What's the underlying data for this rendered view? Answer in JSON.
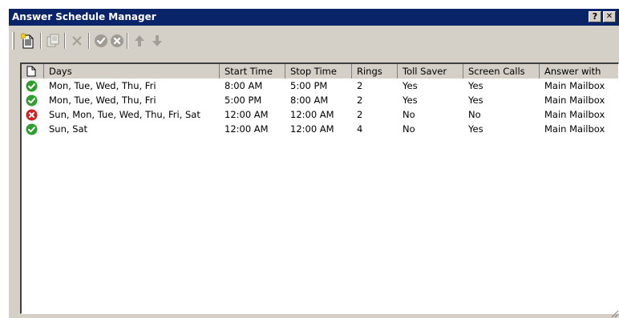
{
  "window": {
    "title": "Answer Schedule Manager",
    "help_label": "?",
    "close_label": "✕"
  },
  "toolbar": {
    "buttons": [
      {
        "name": "new-schedule",
        "icon": "new-document-icon",
        "enabled": true
      },
      {
        "name": "properties",
        "icon": "properties-icon",
        "enabled": false
      },
      {
        "name": "delete",
        "icon": "delete-icon",
        "enabled": false
      },
      {
        "name": "enable",
        "icon": "check-icon",
        "enabled": false
      },
      {
        "name": "disable",
        "icon": "disable-icon",
        "enabled": false
      },
      {
        "name": "move-up",
        "icon": "arrow-up-icon",
        "enabled": false
      },
      {
        "name": "move-down",
        "icon": "arrow-down-icon",
        "enabled": false
      }
    ]
  },
  "table": {
    "columns": [
      "",
      "Days",
      "Start Time",
      "Stop Time",
      "Rings",
      "Toll Saver",
      "Screen Calls",
      "Answer with"
    ],
    "rows": [
      {
        "status": "enabled",
        "days": "Mon, Tue, Wed, Thu, Fri",
        "start": "8:00 AM",
        "stop": "5:00 PM",
        "rings": "2",
        "toll_saver": "Yes",
        "screen_calls": "Yes",
        "answer_with": "Main Mailbox"
      },
      {
        "status": "enabled",
        "days": "Mon, Tue, Wed, Thu, Fri",
        "start": "5:00 PM",
        "stop": "8:00 AM",
        "rings": "2",
        "toll_saver": "Yes",
        "screen_calls": "Yes",
        "answer_with": "Main Mailbox"
      },
      {
        "status": "disabled",
        "days": "Sun, Mon, Tue, Wed, Thu, Fri, Sat",
        "start": "12:00 AM",
        "stop": "12:00 AM",
        "rings": "2",
        "toll_saver": "No",
        "screen_calls": "No",
        "answer_with": "Main Mailbox"
      },
      {
        "status": "enabled",
        "days": "Sun, Sat",
        "start": "12:00 AM",
        "stop": "12:00 AM",
        "rings": "4",
        "toll_saver": "No",
        "screen_calls": "Yes",
        "answer_with": "Main Mailbox"
      }
    ]
  },
  "colors": {
    "titlebar": "#0a246a",
    "face": "#d4d0c8",
    "enabled_status": "#2e9e2e",
    "disabled_status": "#d62020"
  }
}
